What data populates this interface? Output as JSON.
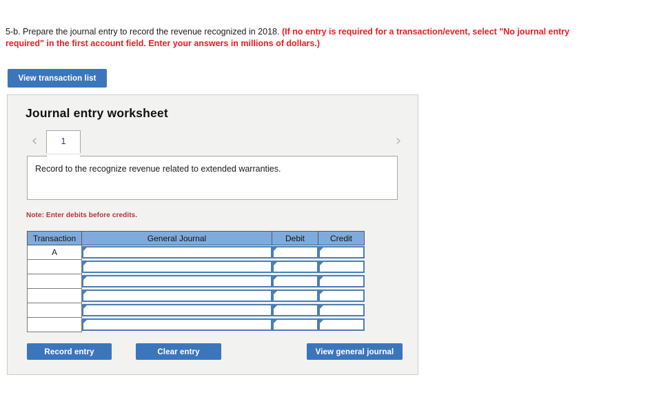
{
  "question": {
    "normal_text": "5-b. Prepare the journal entry to record the revenue recognized in 2018. ",
    "emphasis_text": "(If no entry is required for a transaction/event, select \"No journal entry required\" in the first account field. Enter your answers in millions of dollars.)"
  },
  "toolbar": {
    "view_transaction_list_label": "View transaction list"
  },
  "worksheet": {
    "title": "Journal entry worksheet",
    "tabs": [
      {
        "label": "1",
        "selected": true
      }
    ],
    "prev_arrow_glyph": "‹",
    "next_arrow_glyph": "›",
    "description": "Record to the recognize revenue related to extended warranties.",
    "note": "Note: Enter debits before credits.",
    "table": {
      "headers": [
        "Transaction",
        "General Journal",
        "Debit",
        "Credit"
      ],
      "rows": [
        {
          "transaction": "A",
          "general_journal": "",
          "debit": "",
          "credit": ""
        },
        {
          "transaction": "",
          "general_journal": "",
          "debit": "",
          "credit": ""
        },
        {
          "transaction": "",
          "general_journal": "",
          "debit": "",
          "credit": ""
        },
        {
          "transaction": "",
          "general_journal": "",
          "debit": "",
          "credit": ""
        },
        {
          "transaction": "",
          "general_journal": "",
          "debit": "",
          "credit": ""
        },
        {
          "transaction": "",
          "general_journal": "",
          "debit": "",
          "credit": ""
        }
      ]
    },
    "buttons": {
      "record_entry": "Record entry",
      "clear_entry": "Clear entry",
      "view_general_journal": "View general journal"
    }
  },
  "colors": {
    "button_blue": "#3b76bc",
    "header_blue": "#7fabdc",
    "field_border_blue": "#4a7eb5",
    "emphasis_red": "#ed1c24",
    "note_red": "#b03434",
    "panel_gray": "#f2f2f1"
  }
}
